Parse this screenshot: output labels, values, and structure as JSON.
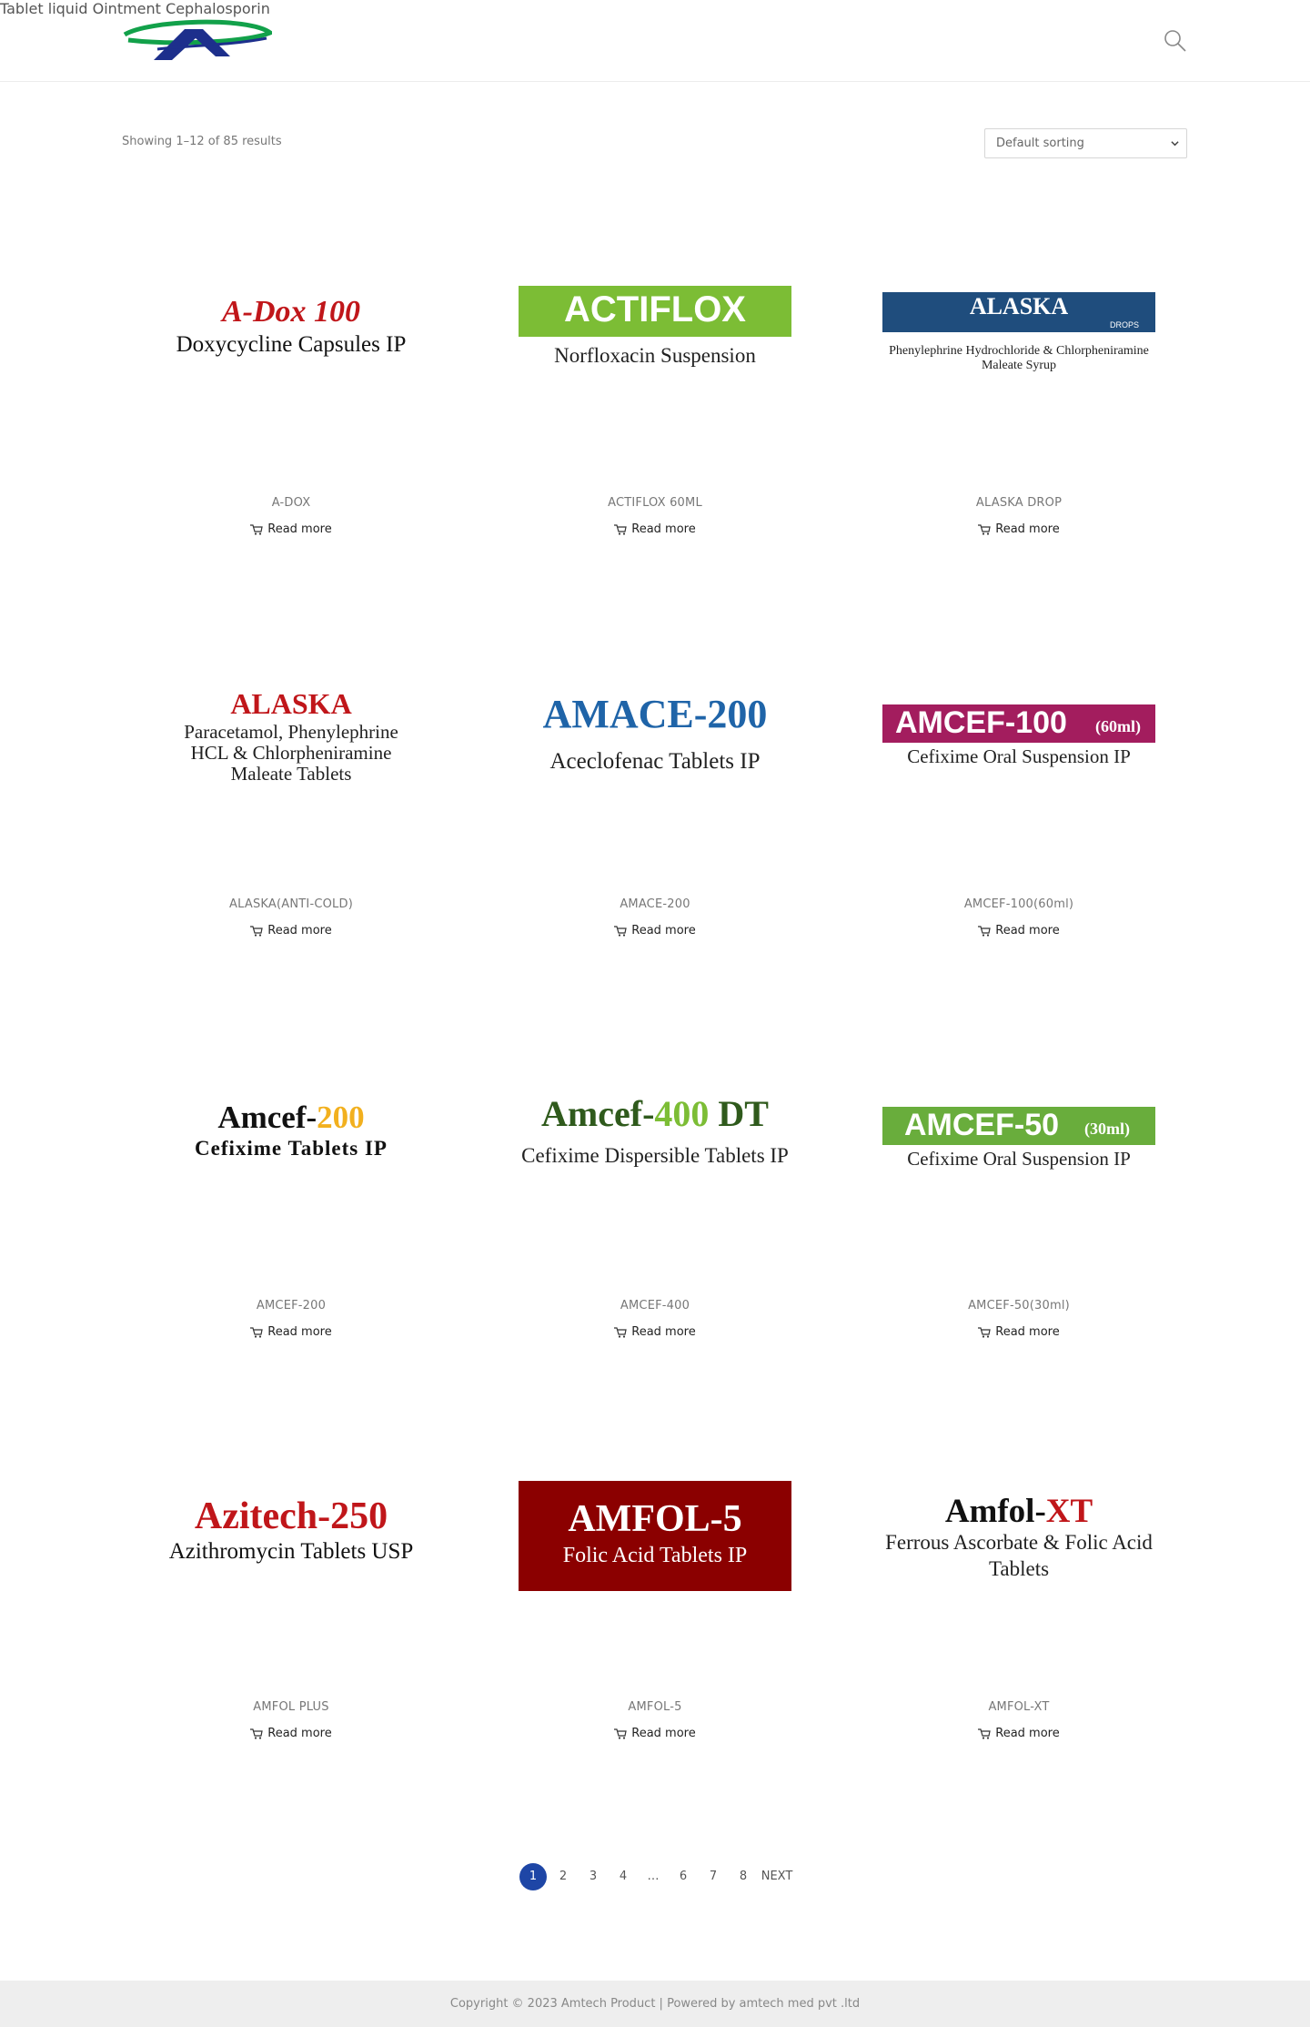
{
  "header": {
    "nav": [
      "Tablet",
      "liquid",
      "Ointment",
      "Cephalosporin"
    ]
  },
  "toolbar": {
    "result_count": "Showing 1–12 of 85 results",
    "sorting_selected": "Default sorting"
  },
  "products": [
    {
      "name": "A-DOX",
      "read_more": "Read more",
      "label": {
        "title": "A-Dox 100",
        "subtitle": "Doxycycline Capsules IP"
      }
    },
    {
      "name": "ACTIFLOX 60ML",
      "read_more": "Read more",
      "label": {
        "title": "ACTIFLOX",
        "subtitle": "Norfloxacin Suspension"
      }
    },
    {
      "name": "ALASKA DROP",
      "read_more": "Read more",
      "label": {
        "title": "ALASKA",
        "tag": "DROPS",
        "subtitle_1": "Phenylephrine Hydrochloride & Chlorpheniramine",
        "subtitle_2": "Maleate Syrup"
      }
    },
    {
      "name": "ALASKA(ANTI-COLD)",
      "read_more": "Read more",
      "label": {
        "title": "ALASKA",
        "subtitle_1": "Paracetamol, Phenylephrine",
        "subtitle_2": "HCL & Chlorpheniramine",
        "subtitle_3": "Maleate Tablets"
      }
    },
    {
      "name": "AMACE-200",
      "read_more": "Read more",
      "label": {
        "title": "AMACE-200",
        "subtitle": "Aceclofenac Tablets IP"
      }
    },
    {
      "name": "AMCEF-100(60ml)",
      "read_more": "Read more",
      "label": {
        "title": "AMCEF-100",
        "tag": "(60ml)",
        "subtitle": "Cefixime Oral Suspension IP"
      }
    },
    {
      "name": "AMCEF-200",
      "read_more": "Read more",
      "label": {
        "title_a": "Amcef-",
        "title_b": "200",
        "subtitle": "Cefixime Tablets IP"
      }
    },
    {
      "name": "AMCEF-400",
      "read_more": "Read more",
      "label": {
        "title_a": "Amcef-",
        "title_b": "400",
        "title_c": " DT",
        "subtitle": "Cefixime Dispersible Tablets IP"
      }
    },
    {
      "name": "AMCEF-50(30ml)",
      "read_more": "Read more",
      "label": {
        "title": "AMCEF-50",
        "tag": "(30ml)",
        "subtitle": "Cefixime Oral Suspension IP"
      }
    },
    {
      "name": "AMFOL PLUS",
      "read_more": "Read more",
      "label": {
        "title": "Azitech-250",
        "subtitle": "Azithromycin Tablets USP"
      }
    },
    {
      "name": "AMFOL-5",
      "read_more": "Read more",
      "label": {
        "title": "AMFOL-5",
        "subtitle": "Folic Acid Tablets IP"
      }
    },
    {
      "name": "AMFOL-XT",
      "read_more": "Read more",
      "label": {
        "title_a": "Amfol-",
        "title_b": "XT",
        "subtitle_1": "Ferrous Ascorbate & Folic Acid",
        "subtitle_2": "Tablets"
      }
    }
  ],
  "pagination": {
    "pages": [
      "1",
      "2",
      "3",
      "4",
      "…",
      "6",
      "7",
      "8"
    ],
    "current": "1",
    "next": "NEXT"
  },
  "footer": {
    "copyright": "Copyright © 2023 Amtech Product | Powered by amtech med pvt .ltd"
  },
  "colors": {
    "accent": "#1e46a6",
    "logo_green": "#12a14a",
    "logo_blue": "#1d2f8c"
  }
}
